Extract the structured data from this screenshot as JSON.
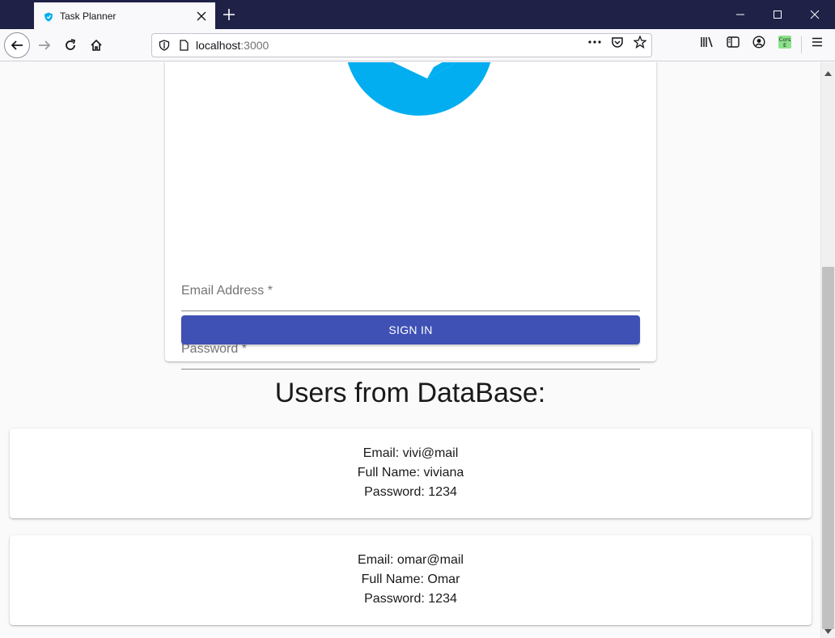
{
  "browser": {
    "tab_title": "Task Planner",
    "url_host": "localhost",
    "url_port": ":3000",
    "extension_badge": "Cors E"
  },
  "login": {
    "email_label": "Email Address *",
    "password_label": "Password *",
    "signin_label": "SIGN IN"
  },
  "users": {
    "heading": "Users from DataBase:",
    "list": [
      {
        "email": "Email: vivi@mail",
        "full_name": "Full Name: viviana",
        "password": "Password: 1234"
      },
      {
        "email": "Email: omar@mail",
        "full_name": "Full Name: Omar",
        "password": "Password: 1234"
      }
    ]
  },
  "colors": {
    "accent": "#3f51b5",
    "logo": "#03aef0",
    "titlebar": "#1f2147"
  }
}
